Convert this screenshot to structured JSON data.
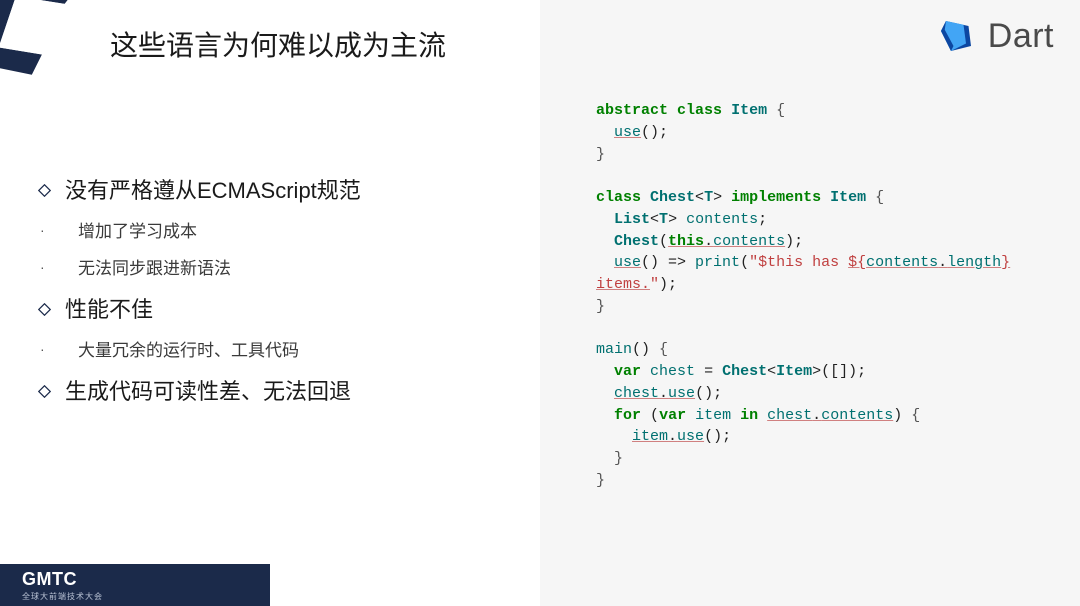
{
  "slide": {
    "title": "这些语言为何难以成为主流",
    "bullets": [
      {
        "level": "main",
        "text": "没有严格遵从ECMAScript规范"
      },
      {
        "level": "sub",
        "text": "增加了学习成本"
      },
      {
        "level": "sub",
        "text": "无法同步跟进新语法"
      },
      {
        "level": "main",
        "text": "性能不佳"
      },
      {
        "level": "sub",
        "text": "大量冗余的运行时、工具代码"
      },
      {
        "level": "main",
        "text": "生成代码可读性差、无法回退"
      }
    ]
  },
  "brand": {
    "name": "Dart"
  },
  "code": {
    "tokens": [
      [
        "kw",
        "abstract"
      ],
      [
        "sp",
        " "
      ],
      [
        "kw",
        "class"
      ],
      [
        "sp",
        " "
      ],
      [
        "ty",
        "Item"
      ],
      [
        "sp",
        " "
      ],
      [
        "bl",
        "{"
      ],
      [
        "nl"
      ],
      [
        "sp",
        "  "
      ],
      [
        "mn us",
        "use"
      ],
      [
        "op",
        "();"
      ],
      [
        "nl"
      ],
      [
        "bl",
        "}"
      ],
      [
        "nl"
      ],
      [
        "nl"
      ],
      [
        "kw",
        "class"
      ],
      [
        "sp",
        " "
      ],
      [
        "ty",
        "Chest"
      ],
      [
        "op",
        "<"
      ],
      [
        "ty",
        "T"
      ],
      [
        "op",
        "> "
      ],
      [
        "kw",
        "implements"
      ],
      [
        "sp",
        " "
      ],
      [
        "ty",
        "Item"
      ],
      [
        "sp",
        " "
      ],
      [
        "bl",
        "{"
      ],
      [
        "nl"
      ],
      [
        "sp",
        "  "
      ],
      [
        "ty",
        "List"
      ],
      [
        "op",
        "<"
      ],
      [
        "ty",
        "T"
      ],
      [
        "op",
        "> "
      ],
      [
        "vn",
        "contents"
      ],
      [
        "op",
        ";"
      ],
      [
        "nl"
      ],
      [
        "sp",
        "  "
      ],
      [
        "ty",
        "Chest"
      ],
      [
        "op",
        "("
      ],
      [
        "kw us",
        "this"
      ],
      [
        "op us",
        "."
      ],
      [
        "vn us",
        "contents"
      ],
      [
        "op",
        ");"
      ],
      [
        "nl"
      ],
      [
        "sp",
        "  "
      ],
      [
        "mn us",
        "use"
      ],
      [
        "op",
        "() => "
      ],
      [
        "mn",
        "print"
      ],
      [
        "op",
        "("
      ],
      [
        "st",
        "\"$this has "
      ],
      [
        "st us",
        "${"
      ],
      [
        "vn us",
        "contents"
      ],
      [
        "op us",
        "."
      ],
      [
        "vn us",
        "length"
      ],
      [
        "st us",
        "}"
      ],
      [
        "nl"
      ],
      [
        "st us",
        "items."
      ],
      [
        "st",
        "\""
      ],
      [
        "op",
        ");"
      ],
      [
        "nl"
      ],
      [
        "bl",
        "}"
      ],
      [
        "nl"
      ],
      [
        "nl"
      ],
      [
        "mn",
        "main"
      ],
      [
        "op",
        "() "
      ],
      [
        "bl",
        "{"
      ],
      [
        "nl"
      ],
      [
        "sp",
        "  "
      ],
      [
        "kw",
        "var"
      ],
      [
        "sp",
        " "
      ],
      [
        "vn",
        "chest"
      ],
      [
        "op",
        " = "
      ],
      [
        "ty",
        "Chest"
      ],
      [
        "op",
        "<"
      ],
      [
        "ty",
        "Item"
      ],
      [
        "op",
        ">([]);"
      ],
      [
        "nl"
      ],
      [
        "sp",
        "  "
      ],
      [
        "vn us",
        "chest"
      ],
      [
        "op us",
        "."
      ],
      [
        "mn us",
        "use"
      ],
      [
        "op",
        "();"
      ],
      [
        "nl"
      ],
      [
        "sp",
        "  "
      ],
      [
        "kw",
        "for"
      ],
      [
        "sp",
        " "
      ],
      [
        "op",
        "("
      ],
      [
        "kw",
        "var"
      ],
      [
        "sp",
        " "
      ],
      [
        "vn",
        "item"
      ],
      [
        "sp",
        " "
      ],
      [
        "kw",
        "in"
      ],
      [
        "sp",
        " "
      ],
      [
        "vn us",
        "chest"
      ],
      [
        "op us",
        "."
      ],
      [
        "vn us",
        "contents"
      ],
      [
        "op",
        ") "
      ],
      [
        "bl",
        "{"
      ],
      [
        "nl"
      ],
      [
        "sp",
        "    "
      ],
      [
        "vn us",
        "item"
      ],
      [
        "op us",
        "."
      ],
      [
        "mn us",
        "use"
      ],
      [
        "op",
        "();"
      ],
      [
        "nl"
      ],
      [
        "sp",
        "  "
      ],
      [
        "bl",
        "}"
      ],
      [
        "nl"
      ],
      [
        "bl",
        "}"
      ]
    ]
  },
  "footer": {
    "logo": "GMTC",
    "sub": "全球大前端技术大会"
  }
}
